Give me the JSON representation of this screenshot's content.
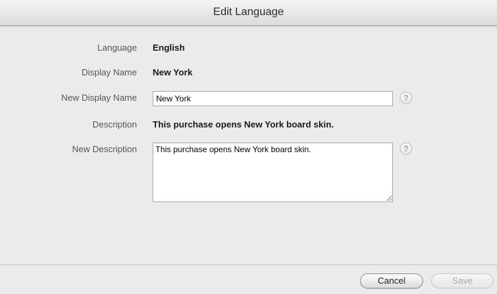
{
  "dialog": {
    "title": "Edit Language"
  },
  "form": {
    "language": {
      "label": "Language",
      "value": "English"
    },
    "display_name": {
      "label": "Display Name",
      "value": "New York"
    },
    "new_display_name": {
      "label": "New Display Name",
      "value": "New York",
      "help_icon": "question-mark"
    },
    "description": {
      "label": "Description",
      "value": "This purchase opens New York board skin."
    },
    "new_description": {
      "label": "New Description",
      "value": "This purchase opens New York board skin.",
      "help_icon": "question-mark"
    },
    "help_glyph": "?"
  },
  "footer": {
    "cancel_label": "Cancel",
    "save_label": "Save",
    "save_enabled": false
  }
}
